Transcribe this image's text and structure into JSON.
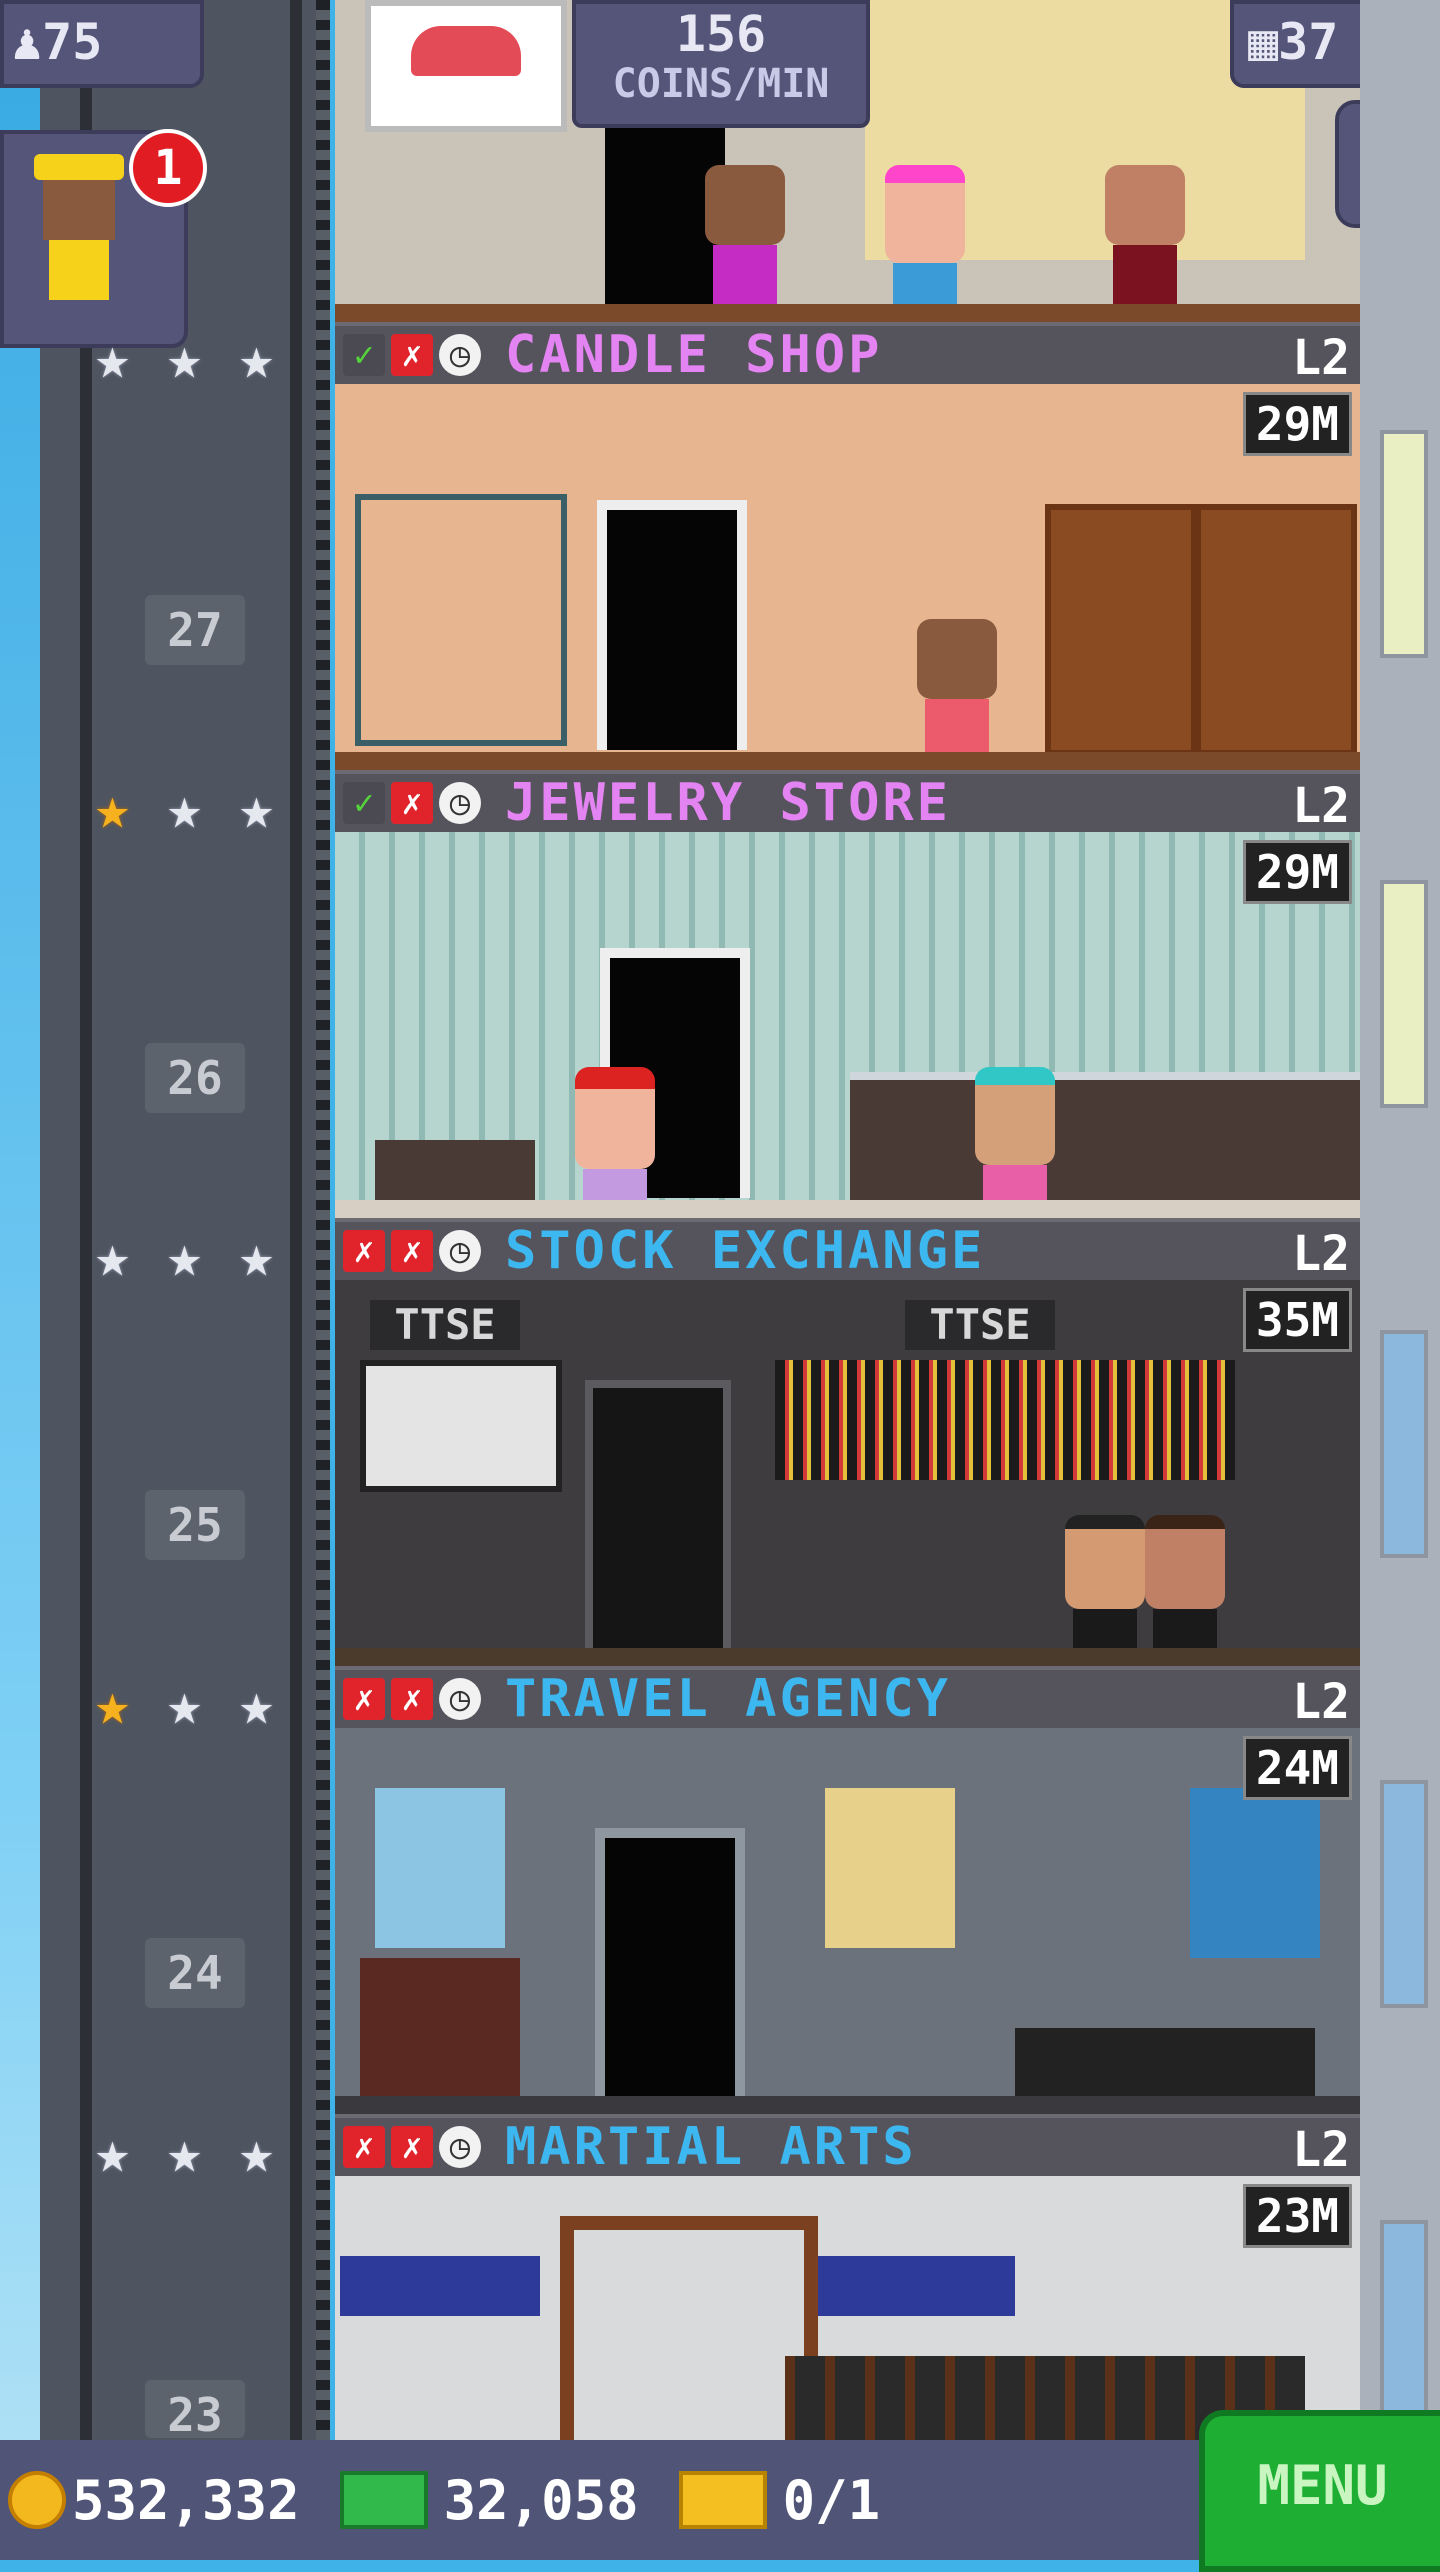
{
  "top": {
    "population": "75",
    "coins_rate_value": "156",
    "coins_rate_unit": "COINS/MIN",
    "floors_count": "37",
    "vip_badge": "1"
  },
  "floors": [
    {
      "name": "CANDLE SHOP",
      "level": "L2",
      "time": "29M",
      "number": "27",
      "stars_gold": 0,
      "name_color": "#e483f2"
    },
    {
      "name": "JEWELRY STORE",
      "level": "L2",
      "time": "29M",
      "number": "26",
      "stars_gold": 1,
      "name_color": "#e483f2"
    },
    {
      "name": "STOCK EXCHANGE",
      "level": "L2",
      "time": "35M",
      "number": "25",
      "stars_gold": 0,
      "name_color": "#3db7f0"
    },
    {
      "name": "TRAVEL AGENCY",
      "level": "L2",
      "time": "24M",
      "number": "24",
      "stars_gold": 1,
      "name_color": "#3db7f0"
    },
    {
      "name": "MARTIAL ARTS",
      "level": "L2",
      "time": "23M",
      "number": "23",
      "stars_gold": 0,
      "name_color": "#3db7f0"
    }
  ],
  "stock_exchange": {
    "sign_left": "TTSE",
    "sign_right": "TTSE"
  },
  "bottom": {
    "coins": "532,332",
    "bux": "32,058",
    "tickets": "0/1",
    "menu_label": "MENU"
  },
  "icons": {
    "population": "person-icon",
    "floors": "building-icon",
    "search": "magnifier-icon",
    "coin": "coin-icon",
    "bux": "cash-icon",
    "ticket": "ticket-icon"
  }
}
